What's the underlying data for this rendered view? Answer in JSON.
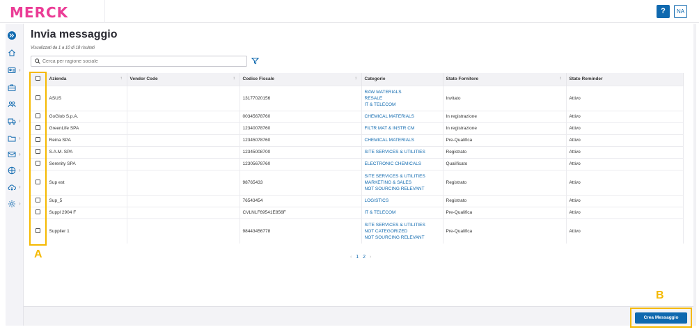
{
  "header": {
    "logo": "MERCK",
    "help_label": "?",
    "user_initials": "NA"
  },
  "sidebar": {
    "items": [
      {
        "icon": "expand-icon"
      },
      {
        "icon": "home-icon"
      },
      {
        "icon": "contact-card-icon"
      },
      {
        "icon": "briefcase-icon"
      },
      {
        "icon": "users-icon"
      },
      {
        "icon": "truck-icon"
      },
      {
        "icon": "folder-icon"
      },
      {
        "icon": "mail-icon"
      },
      {
        "icon": "globe-icon"
      },
      {
        "icon": "cloud-download-icon"
      },
      {
        "icon": "settings-icon"
      }
    ]
  },
  "main": {
    "title": "Invia messaggio",
    "result_count": "Visualizzati da 1 a 10 di 18 risultati",
    "search_placeholder": "Cerca per ragione sociale"
  },
  "table": {
    "headers": [
      "Azienda",
      "Vendor Code",
      "Codice Fiscale",
      "Categorie",
      "Stato Fornitore",
      "Stato Reminder"
    ],
    "rows": [
      {
        "azienda": "ASUS",
        "vendor": "",
        "cf": "13177020156",
        "cat": [
          "RAW MATERIALS",
          "RESALE",
          "IT & TELECOM"
        ],
        "stato": "Invitato",
        "reminder": "Attivo"
      },
      {
        "azienda": "GoGlob S.p.A.",
        "vendor": "",
        "cf": "00345678760",
        "cat": [
          "CHEMICAL MATERIALS"
        ],
        "stato": "In registrazione",
        "reminder": "Attivo"
      },
      {
        "azienda": "GreenLife SPA",
        "vendor": "",
        "cf": "12340078760",
        "cat": [
          "FILTR MAT & INSTR CM"
        ],
        "stato": "In registrazione",
        "reminder": "Attivo"
      },
      {
        "azienda": "Reina SPA",
        "vendor": "",
        "cf": "12345078760",
        "cat": [
          "CHEMICAL MATERIALS"
        ],
        "stato": "Pre-Qualifica",
        "reminder": "Attivo"
      },
      {
        "azienda": "S.A.M. SPA",
        "vendor": "",
        "cf": "12345008700",
        "cat": [
          "SITE SERVICES & UTILITIES"
        ],
        "stato": "Registrato",
        "reminder": "Attivo"
      },
      {
        "azienda": "Serenity SPA",
        "vendor": "",
        "cf": "12305678760",
        "cat": [
          "ELECTRONIC CHEMICALS"
        ],
        "stato": "Qualificato",
        "reminder": "Attivo"
      },
      {
        "azienda": "Sup est",
        "vendor": "",
        "cf": "98765433",
        "cat": [
          "SITE SERVICES & UTILITIES",
          "MARKETING & SALES",
          "NOT SOURCING RELEVANT"
        ],
        "stato": "Registrato",
        "reminder": "Attivo"
      },
      {
        "azienda": "Sup_5",
        "vendor": "",
        "cf": "76543454",
        "cat": [
          "LOGISTICS"
        ],
        "stato": "Registrato",
        "reminder": "Attivo"
      },
      {
        "azienda": "Suppl 2904 F",
        "vendor": "",
        "cf": "CVLNLF69541E856F",
        "cat": [
          "IT & TELECOM"
        ],
        "stato": "Pre-Qualifica",
        "reminder": "Attivo"
      },
      {
        "azienda": "Supplier 1",
        "vendor": "",
        "cf": "98443456778",
        "cat": [
          "SITE SERVICES & UTILITIES",
          "NOT CATEGORIZED",
          "NOT SOURCING RELEVANT"
        ],
        "stato": "Pre-Qualifica",
        "reminder": "Attivo"
      }
    ]
  },
  "pagination": {
    "prev": "‹",
    "pages": [
      "1",
      "2"
    ],
    "next": "›",
    "current": "1"
  },
  "footer": {
    "create_label": "Crea Messaggio"
  },
  "annotations": {
    "a": "A",
    "b": "B"
  },
  "colors": {
    "brand": "#eb3c96",
    "primary": "#0f69af",
    "highlight": "#f5b900"
  }
}
